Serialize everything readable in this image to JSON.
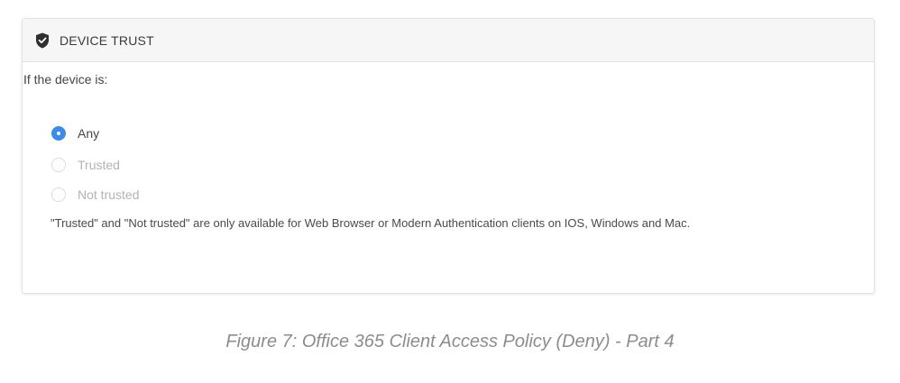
{
  "panel": {
    "title": "DEVICE TRUST",
    "icon": "shield-check-icon"
  },
  "question": "If the device is:",
  "options": [
    {
      "label": "Any",
      "selected": true,
      "enabled": true
    },
    {
      "label": "Trusted",
      "selected": false,
      "enabled": false
    },
    {
      "label": "Not trusted",
      "selected": false,
      "enabled": false
    }
  ],
  "note": "\"Trusted\" and \"Not trusted\" are only available for Web Browser or Modern Authentication clients on IOS, Windows and Mac.",
  "caption": "Figure 7: Office 365 Client Access Policy (Deny) - Part 4",
  "colors": {
    "accent": "#3d8be8",
    "disabled_text": "#b3b3b3",
    "caption_text": "#8c8c8c"
  }
}
